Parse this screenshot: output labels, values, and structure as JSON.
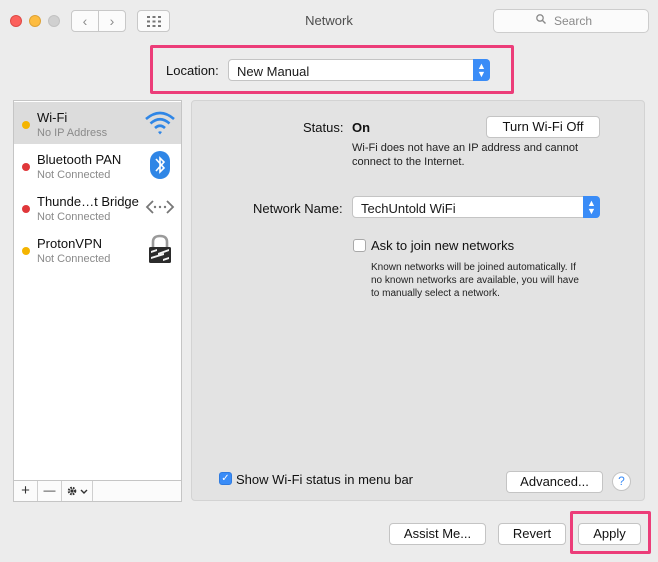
{
  "window": {
    "title": "Network"
  },
  "toolbar": {
    "back_glyph": "‹",
    "forward_glyph": "›",
    "search_placeholder": "Search"
  },
  "colors": {
    "highlight": "#ec3d79",
    "accent": "#3a8cf7",
    "status_yellow": "#f4b400",
    "status_red": "#e0373a"
  },
  "location": {
    "label": "Location:",
    "value": "New Manual"
  },
  "services": [
    {
      "name": "Wi-Fi",
      "status": "No IP Address",
      "dot": "yellow",
      "icon": "wifi-icon",
      "selected": true
    },
    {
      "name": "Bluetooth PAN",
      "status": "Not Connected",
      "dot": "red",
      "icon": "bluetooth-icon",
      "selected": false
    },
    {
      "name": "Thunde…t Bridge",
      "status": "Not Connected",
      "dot": "red",
      "icon": "thunderbolt-bridge-icon",
      "selected": false
    },
    {
      "name": "ProtonVPN",
      "status": "Not Connected",
      "dot": "yellow",
      "icon": "vpn-lock-icon",
      "selected": false
    }
  ],
  "sidebar_bar": {
    "add": "+",
    "remove": "—"
  },
  "detail": {
    "status_label": "Status:",
    "status_value": "On",
    "turn_off_button": "Turn Wi-Fi Off",
    "status_desc_1": "Wi-Fi does not have an IP address and cannot",
    "status_desc_2": "connect to the Internet.",
    "network_name_label": "Network Name:",
    "network_name_value": "TechUntold WiFi",
    "ask_join_label": "Ask to join new networks",
    "ask_join_checked": false,
    "ask_desc_1": "Known networks will be joined automatically. If",
    "ask_desc_2": "no known networks are available, you will have",
    "ask_desc_3": "to manually select a network.",
    "show_status_label": "Show Wi-Fi status in menu bar",
    "show_status_checked": true,
    "advanced_button": "Advanced...",
    "help_glyph": "?"
  },
  "footer": {
    "assist_button": "Assist Me...",
    "revert_button": "Revert",
    "apply_button": "Apply"
  }
}
